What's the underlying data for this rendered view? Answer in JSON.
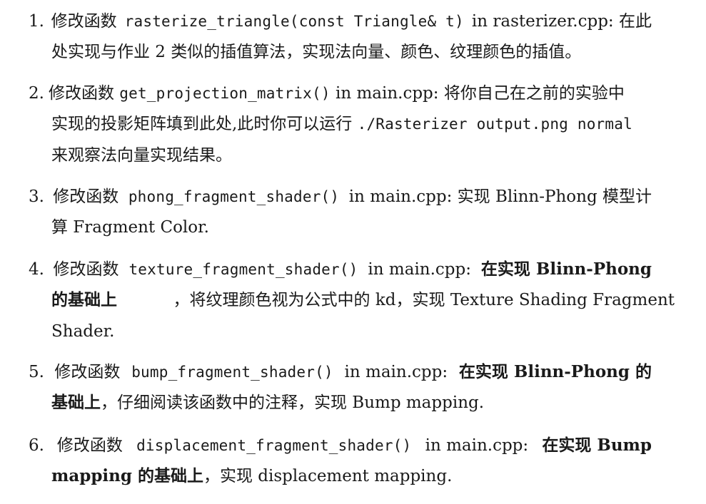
{
  "items": [
    {
      "number": "1.",
      "lines": [
        [
          {
            "t": "修改函数 ",
            "s": "cjk"
          },
          {
            "t": "rasterize_triangle(const Triangle& t)",
            "s": "code"
          },
          {
            "t": " in rasterizer.cpp: 在此",
            "s": "text"
          }
        ],
        [
          {
            "t": "处实现与作业 2 类似的插值算法，实现法向量、颜色、纹理颜色的插值。",
            "s": "text"
          }
        ]
      ]
    },
    {
      "number": "2.",
      "lines": [
        [
          {
            "t": "修改函数 ",
            "s": "cjk"
          },
          {
            "t": "get_projection_matrix()",
            "s": "code"
          },
          {
            "t": " in main.cpp: 将你自己在之前的实验中",
            "s": "text"
          }
        ],
        [
          {
            "t": "实现的投影矩阵填到此处,此时你可以运行 ",
            "s": "text"
          },
          {
            "t": "./Rasterizer output.png normal",
            "s": "code"
          }
        ],
        [
          {
            "t": "来观察法向量实现结果。",
            "s": "text"
          }
        ]
      ]
    },
    {
      "number": "3.",
      "lines": [
        [
          {
            "t": "修改函数 ",
            "s": "cjk"
          },
          {
            "t": "phong_fragment_shader()",
            "s": "code"
          },
          {
            "t": " in main.cpp: 实现 Blinn-Phong 模型计",
            "s": "text"
          }
        ],
        [
          {
            "t": "算 Fragment Color.",
            "s": "text"
          }
        ]
      ]
    },
    {
      "number": "4.",
      "lines": [
        [
          {
            "t": "修改函数 ",
            "s": "cjk"
          },
          {
            "t": "texture_fragment_shader()",
            "s": "code"
          },
          {
            "t": " in main.cpp: ",
            "s": "text"
          },
          {
            "t": "在实现 Blinn-Phong",
            "s": "bold"
          }
        ],
        [
          {
            "t": "的基础上",
            "s": "bold"
          },
          {
            "t": "，将纹理颜色视为公式中的 kd，实现 Texture Shading Fragment",
            "s": "text"
          }
        ],
        [
          {
            "t": "Shader.",
            "s": "text"
          }
        ]
      ]
    },
    {
      "number": "5.",
      "lines": [
        [
          {
            "t": "修改函数 ",
            "s": "cjk"
          },
          {
            "t": "bump_fragment_shader()",
            "s": "code"
          },
          {
            "t": " in main.cpp: ",
            "s": "text"
          },
          {
            "t": "在实现 Blinn-Phong 的",
            "s": "bold"
          }
        ],
        [
          {
            "t": "基础上",
            "s": "bold"
          },
          {
            "t": "，仔细阅读该函数中的注释，实现 Bump mapping.",
            "s": "text"
          }
        ]
      ]
    },
    {
      "number": "6.",
      "lines": [
        [
          {
            "t": "修改函数 ",
            "s": "cjk"
          },
          {
            "t": "displacement_fragment_shader()",
            "s": "code"
          },
          {
            "t": " in main.cpp: ",
            "s": "text"
          },
          {
            "t": "在实现 Bump",
            "s": "bold"
          }
        ],
        [
          {
            "t": "mapping 的基础上",
            "s": "bold"
          },
          {
            "t": "，实现 displacement mapping.",
            "s": "text"
          }
        ]
      ]
    }
  ]
}
